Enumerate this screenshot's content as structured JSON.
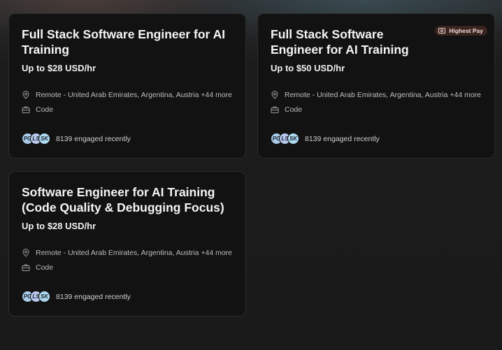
{
  "cards": [
    {
      "title": "Full Stack Software Engineer for AI Training",
      "pay": "Up to $28 USD/hr",
      "location": "Remote - United Arab Emirates, Argentina, Austria +44 more",
      "category": "Code",
      "avatars": [
        "PG",
        "LS",
        "SK"
      ],
      "engaged": "8139 engaged recently"
    },
    {
      "title": "Full Stack Software Engineer for AI Training",
      "badge": "Highest Pay",
      "pay": "Up to $50 USD/hr",
      "location": "Remote - United Arab Emirates, Argentina, Austria +44 more",
      "category": "Code",
      "avatars": [
        "PG",
        "LS",
        "SK"
      ],
      "engaged": "8139 engaged recently"
    },
    {
      "title": "Software Engineer for AI Training (Code Quality & Debugging Focus)",
      "pay": "Up to $28 USD/hr",
      "location": "Remote - United Arab Emirates, Argentina, Austria +44 more",
      "category": "Code",
      "avatars": [
        "PG",
        "LS",
        "SK"
      ],
      "engaged": "8139 engaged recently"
    }
  ],
  "icons": {
    "location": "map-pin-icon",
    "category": "briefcase-icon",
    "badge": "money-icon"
  },
  "colors": {
    "card_bg": "#121212",
    "badge_bg": "#3a2420",
    "badge_text": "#f1d9d2"
  }
}
